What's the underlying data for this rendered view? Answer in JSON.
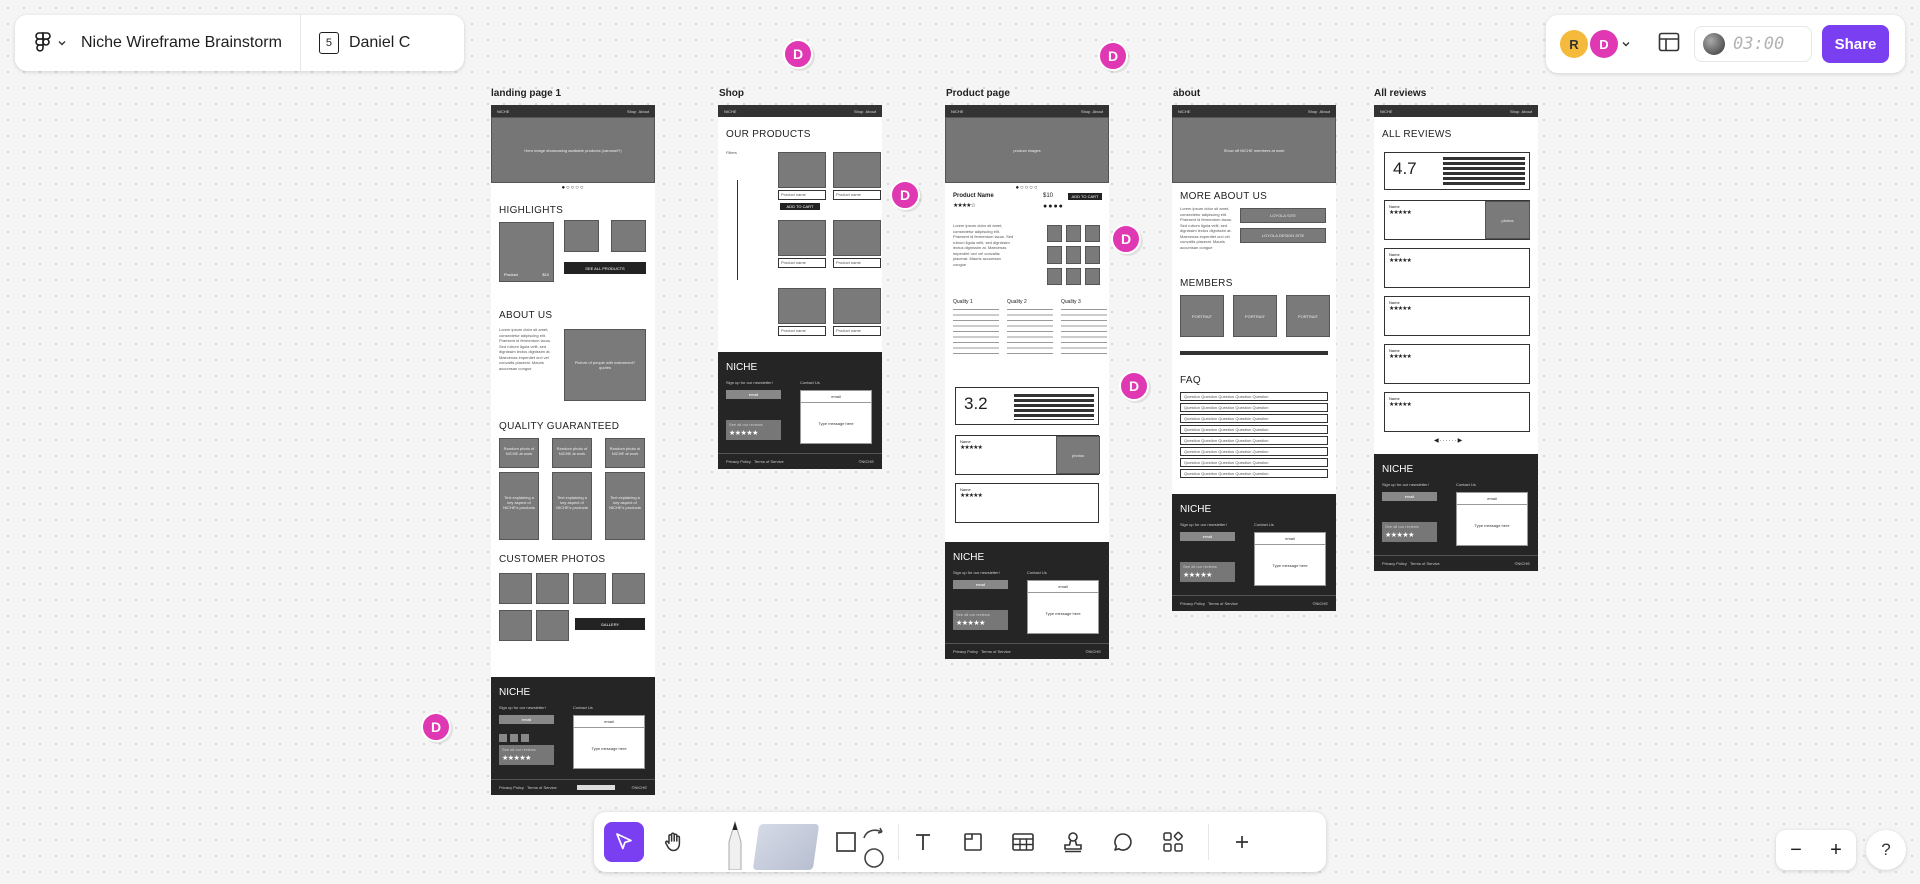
{
  "file": {
    "title": "Niche Wireframe Brainstorm",
    "page_count": "5",
    "user_name": "Daniel C"
  },
  "header_right": {
    "avatar_r": "R",
    "avatar_d": "D",
    "timer": "03:00",
    "share_label": "Share"
  },
  "cursor_label": "D",
  "frames": {
    "landing": {
      "label": "landing page 1",
      "brand": "NICHE",
      "nav": [
        "Shop",
        "About"
      ],
      "hero_text": "Hero image showcasing available products (carousel?)",
      "highlights": "HIGHLIGHTS",
      "product": "Product",
      "price": "$10",
      "see_all": "SEE ALL PRODUCTS",
      "about_us": "ABOUT US",
      "about_text": "Lorem ipsum dolor sit amet, consectetur adipiscing elit. Praesent id fermentum lacus. Sed rutrum ligula velit, sed dignissim lectus dignissim at. Maecenas imperdiet orci vel convallis placerat. Mauris accumsan congue",
      "about_img": "Picture of people with instrument? quotes",
      "quality": "QUALITY GUARANTEED",
      "quality_top": "Random photo of NICHE at work",
      "quality_bottom": "Text explaining a key aspect of NICHE's products",
      "customer_photos": "CUSTOMER PHOTOS",
      "gallery": "GALLERY"
    },
    "shop": {
      "label": "Shop",
      "our_products": "OUR PRODUCTS",
      "filters": "Filters",
      "product_name": "Product name",
      "add_to_cart": "ADD TO CART"
    },
    "product": {
      "label": "Product page",
      "hero_text": "product images",
      "product_name": "Product Name",
      "price": "$10",
      "add_to_cart": "ADD TO CART",
      "qualities": [
        "Quality 1",
        "Quality 2",
        "Quality 3"
      ],
      "rating": "3.2",
      "name": "Name",
      "photos": "photos"
    },
    "about": {
      "label": "about",
      "hero_text": "Show off NICHE members at work",
      "more_about": "MORE ABOUT US",
      "link1": "LOYOLA SITE",
      "link2": "LOYOLA DESIGN SITE",
      "members": "MEMBERS",
      "portrait": "PORTRAIT",
      "faq": "FAQ",
      "question": "Question Question Question Question Question"
    },
    "reviews": {
      "label": "All reviews",
      "all_reviews": "ALL REVIEWS",
      "rating": "4.7",
      "name": "Name",
      "photos": "photos"
    },
    "footer": {
      "brand": "NICHE",
      "signup": "Sign up for our newsletter!",
      "email": "email",
      "contact": "Contact Us",
      "message": "Type message here",
      "see_reviews": "See all our reviews",
      "privacy": "Privacy Policy",
      "terms": "Terms of Service",
      "copyright": "©NICHE"
    }
  },
  "toolbar": {
    "tools": [
      "move-tool",
      "hand-tool",
      "pen-tool",
      "marker-tool",
      "shape-tool",
      "connector-tool",
      "text-tool",
      "section-tool",
      "table-tool",
      "stamp-tool",
      "comment-tool",
      "widgets-tool",
      "add-tool"
    ]
  },
  "zoom": {
    "minus": "−",
    "plus": "+"
  },
  "help": "?",
  "colors": {
    "accent": "#7b3ff2",
    "cursor": "#e037b3",
    "avatar_r": "#f5b93b"
  }
}
